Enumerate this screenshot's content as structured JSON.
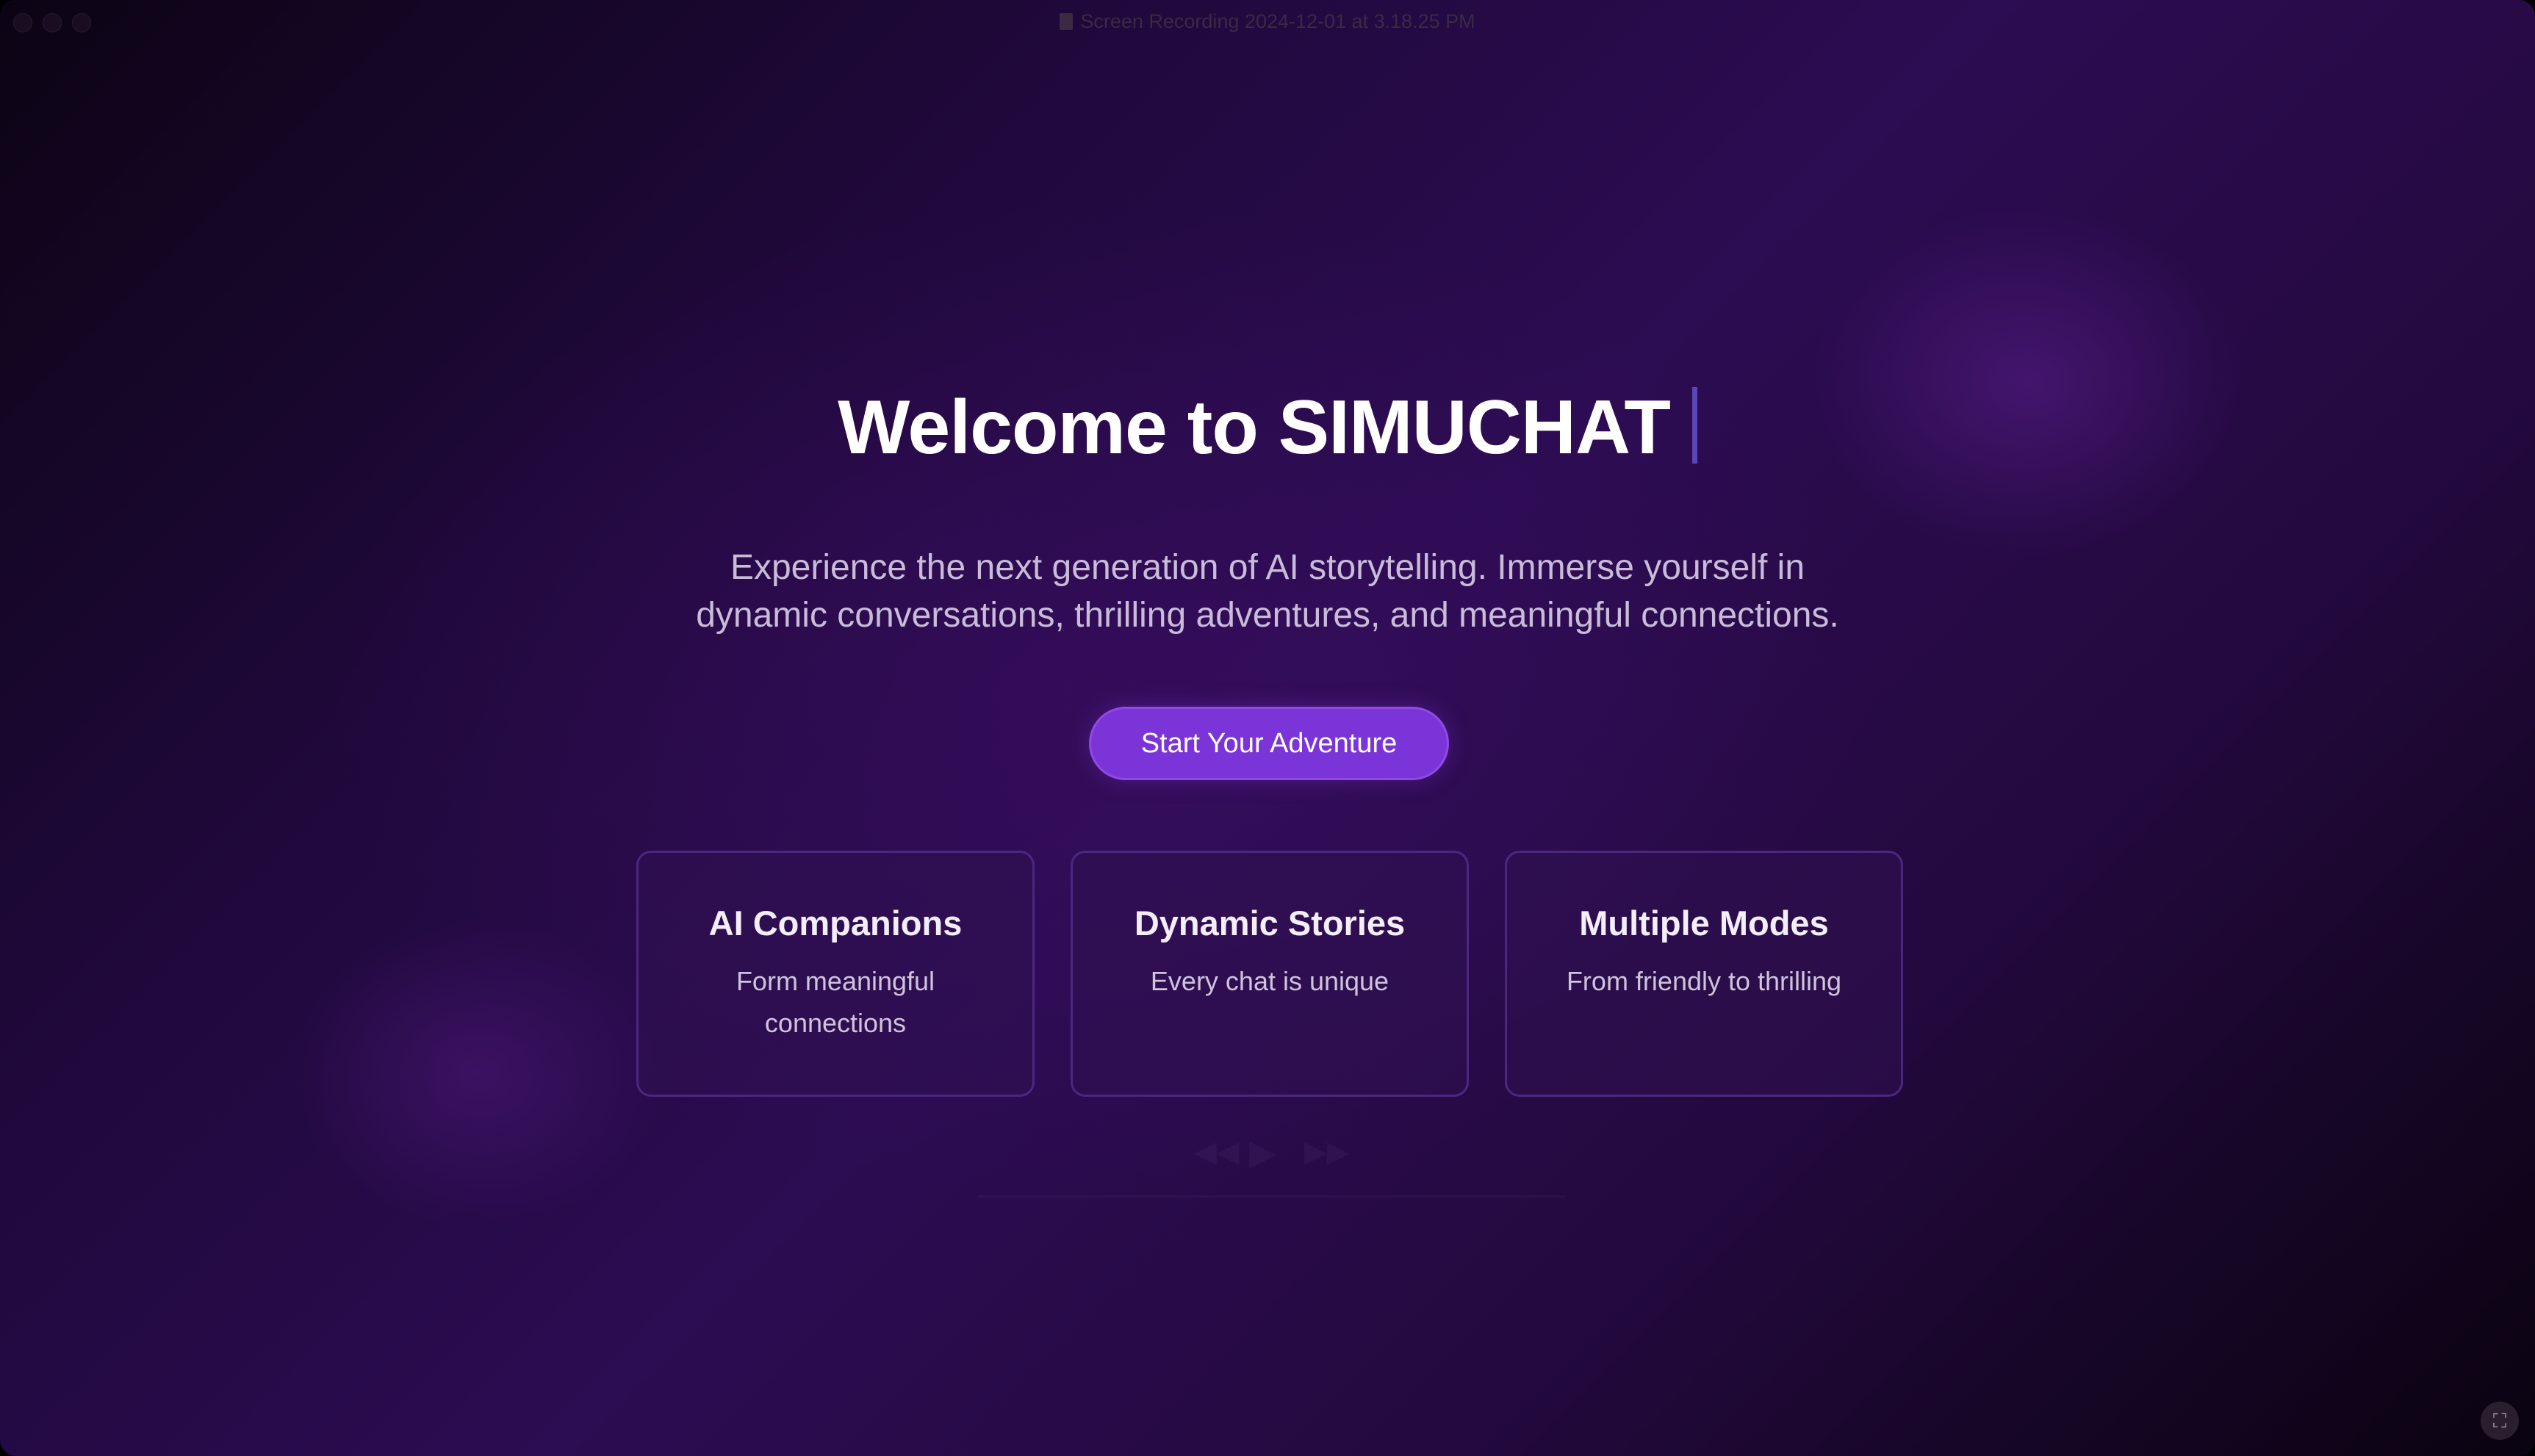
{
  "window": {
    "title": "Screen Recording 2024-12-01 at 3.18.25 PM"
  },
  "hero": {
    "headline": "Welcome to SIMUCHAT",
    "subtitle_line1": "Experience the next generation of AI storytelling. Immerse yourself in",
    "subtitle_line2": "dynamic conversations, thrilling adventures, and meaningful connections.",
    "cta_label": "Start Your Adventure"
  },
  "features": [
    {
      "title": "AI Companions",
      "text": "Form meaningful connections"
    },
    {
      "title": "Dynamic Stories",
      "text": "Every chat is unique"
    },
    {
      "title": "Multiple Modes",
      "text": "From friendly to thrilling"
    }
  ],
  "player_controls": {
    "rewind_icon": "rewind-icon",
    "play_icon": "play-icon",
    "fast_forward_icon": "fast-forward-icon"
  },
  "colors": {
    "background_primary": "#2c0c52",
    "accent": "#7b34d8",
    "card_border": "#4c2782",
    "text_primary": "#ffffff",
    "text_secondary": "#c9bcd8"
  }
}
